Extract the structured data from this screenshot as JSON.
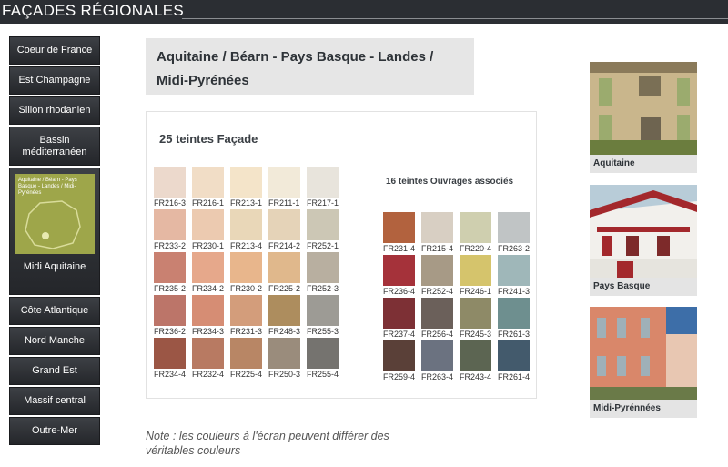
{
  "header": {
    "title": "FAÇADES RÉGIONALES"
  },
  "sidebar": {
    "items": [
      {
        "label": "Coeur de France"
      },
      {
        "label": "Est Champagne"
      },
      {
        "label": "Sillon rhodanien"
      },
      {
        "label": "Bassin méditerranéen"
      },
      {
        "label": "Midi Aquitaine",
        "thumb_text": "Aquitaine / Béarn - Pays Basque - Landes / Midi-Pyrénées"
      },
      {
        "label": "Côte Atlantique"
      },
      {
        "label": "Nord Manche"
      },
      {
        "label": "Grand Est"
      },
      {
        "label": "Massif central"
      },
      {
        "label": "Outre-Mer"
      }
    ]
  },
  "main": {
    "region_title": "Aquitaine / Béarn - Pays Basque - Landes / Midi-Pyrénées",
    "facade_heading": "25 teintes Façade",
    "ouvrage_heading": "16 teintes Ouvrages associés",
    "facade_swatches": [
      {
        "code": "FR216-3",
        "color": "#ecd9cc"
      },
      {
        "code": "FR216-1",
        "color": "#f1ddc6"
      },
      {
        "code": "FR213-1",
        "color": "#f4e4c9"
      },
      {
        "code": "FR211-1",
        "color": "#f2ead9"
      },
      {
        "code": "FR217-1",
        "color": "#e8e4dc"
      },
      {
        "code": "FR233-2",
        "color": "#e5b8a3"
      },
      {
        "code": "FR230-1",
        "color": "#eccab0"
      },
      {
        "code": "FR213-4",
        "color": "#e9d7b8"
      },
      {
        "code": "FR214-2",
        "color": "#e5d3b8"
      },
      {
        "code": "FR252-1",
        "color": "#ccc7b5"
      },
      {
        "code": "FR235-2",
        "color": "#c98171"
      },
      {
        "code": "FR234-2",
        "color": "#e6a88b"
      },
      {
        "code": "FR230-2",
        "color": "#e8b68c"
      },
      {
        "code": "FR225-2",
        "color": "#e0b88c"
      },
      {
        "code": "FR252-3",
        "color": "#b8afa0"
      },
      {
        "code": "FR236-2",
        "color": "#bc7569"
      },
      {
        "code": "FR234-3",
        "color": "#d68d74"
      },
      {
        "code": "FR231-3",
        "color": "#d39d7b"
      },
      {
        "code": "FR248-3",
        "color": "#ad8d5e"
      },
      {
        "code": "FR255-3",
        "color": "#9d9b95"
      },
      {
        "code": "FR234-4",
        "color": "#9b5645"
      },
      {
        "code": "FR232-4",
        "color": "#b87a62"
      },
      {
        "code": "FR225-4",
        "color": "#b88665"
      },
      {
        "code": "FR250-3",
        "color": "#9a8c7c"
      },
      {
        "code": "FR255-4",
        "color": "#75736f"
      }
    ],
    "ouvrage_swatches": [
      {
        "code": "FR231-4",
        "color": "#b2623e"
      },
      {
        "code": "FR215-4",
        "color": "#d8cfc3"
      },
      {
        "code": "FR220-4",
        "color": "#cfcfaf"
      },
      {
        "code": "FR263-2",
        "color": "#c0c4c5"
      },
      {
        "code": "FR236-4",
        "color": "#a5323a"
      },
      {
        "code": "FR252-4",
        "color": "#a79a86"
      },
      {
        "code": "FR246-1",
        "color": "#d5c46c"
      },
      {
        "code": "FR241-3",
        "color": "#9fb7b9"
      },
      {
        "code": "FR237-4",
        "color": "#7d3035"
      },
      {
        "code": "FR256-4",
        "color": "#6b605a"
      },
      {
        "code": "FR245-3",
        "color": "#8e8a67"
      },
      {
        "code": "FR261-3",
        "color": "#6e8f8f"
      },
      {
        "code": "FR259-4",
        "color": "#5a4038"
      },
      {
        "code": "FR263-4",
        "color": "#6b7280"
      },
      {
        "code": "FR243-4",
        "color": "#5c6552"
      },
      {
        "code": "FR261-4",
        "color": "#435a6c"
      }
    ],
    "note": "Note : les couleurs à l'écran peuvent différer des véritables couleurs"
  },
  "photos": [
    {
      "caption": "Aquitaine"
    },
    {
      "caption": "Pays Basque"
    },
    {
      "caption": "Midi-Pyrénnées"
    }
  ]
}
